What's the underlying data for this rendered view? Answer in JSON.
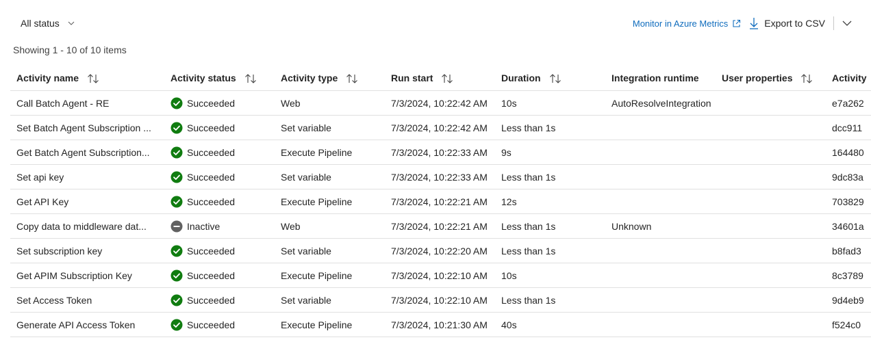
{
  "toolbar": {
    "status_filter_label": "All status",
    "monitor_link": "Monitor in Azure Metrics",
    "export_label": "Export to CSV"
  },
  "summary": {
    "count_text": "Showing 1 - 10 of 10 items"
  },
  "columns": [
    "Activity name",
    "Activity status",
    "Activity type",
    "Run start",
    "Duration",
    "Integration runtime",
    "User properties",
    "Activity"
  ],
  "rows": [
    {
      "name": "Call Batch Agent - RE",
      "status": "Succeeded",
      "type": "Web",
      "run_start": "7/3/2024, 10:22:42 AM",
      "duration": "10s",
      "runtime": "AutoResolveIntegration",
      "user_props": "",
      "activity_id": "e7a262"
    },
    {
      "name": "Set Batch Agent Subscription ...",
      "status": "Succeeded",
      "type": "Set variable",
      "run_start": "7/3/2024, 10:22:42 AM",
      "duration": "Less than 1s",
      "runtime": "",
      "user_props": "",
      "activity_id": "dcc911"
    },
    {
      "name": "Get Batch Agent Subscription...",
      "status": "Succeeded",
      "type": "Execute Pipeline",
      "run_start": "7/3/2024, 10:22:33 AM",
      "duration": "9s",
      "runtime": "",
      "user_props": "",
      "activity_id": "164480"
    },
    {
      "name": "Set api key",
      "status": "Succeeded",
      "type": "Set variable",
      "run_start": "7/3/2024, 10:22:33 AM",
      "duration": "Less than 1s",
      "runtime": "",
      "user_props": "",
      "activity_id": "9dc83a"
    },
    {
      "name": "Get API Key",
      "status": "Succeeded",
      "type": "Execute Pipeline",
      "run_start": "7/3/2024, 10:22:21 AM",
      "duration": "12s",
      "runtime": "",
      "user_props": "",
      "activity_id": "703829"
    },
    {
      "name": "Copy data to middleware dat...",
      "status": "Inactive",
      "type": "Web",
      "run_start": "7/3/2024, 10:22:21 AM",
      "duration": "Less than 1s",
      "runtime": "Unknown",
      "user_props": "",
      "activity_id": "34601a"
    },
    {
      "name": "Set subscription key",
      "status": "Succeeded",
      "type": "Set variable",
      "run_start": "7/3/2024, 10:22:20 AM",
      "duration": "Less than 1s",
      "runtime": "",
      "user_props": "",
      "activity_id": "b8fad3"
    },
    {
      "name": "Get APIM Subscription Key",
      "status": "Succeeded",
      "type": "Execute Pipeline",
      "run_start": "7/3/2024, 10:22:10 AM",
      "duration": "10s",
      "runtime": "",
      "user_props": "",
      "activity_id": "8c3789"
    },
    {
      "name": "Set Access Token",
      "status": "Succeeded",
      "type": "Set variable",
      "run_start": "7/3/2024, 10:22:10 AM",
      "duration": "Less than 1s",
      "runtime": "",
      "user_props": "",
      "activity_id": "9d4eb9"
    },
    {
      "name": "Generate API Access Token",
      "status": "Succeeded",
      "type": "Execute Pipeline",
      "run_start": "7/3/2024, 10:21:30 AM",
      "duration": "40s",
      "runtime": "",
      "user_props": "",
      "activity_id": "f524c0"
    }
  ],
  "colors": {
    "success": "#107c10",
    "inactive": "#616161",
    "link": "#0f6cbd"
  }
}
